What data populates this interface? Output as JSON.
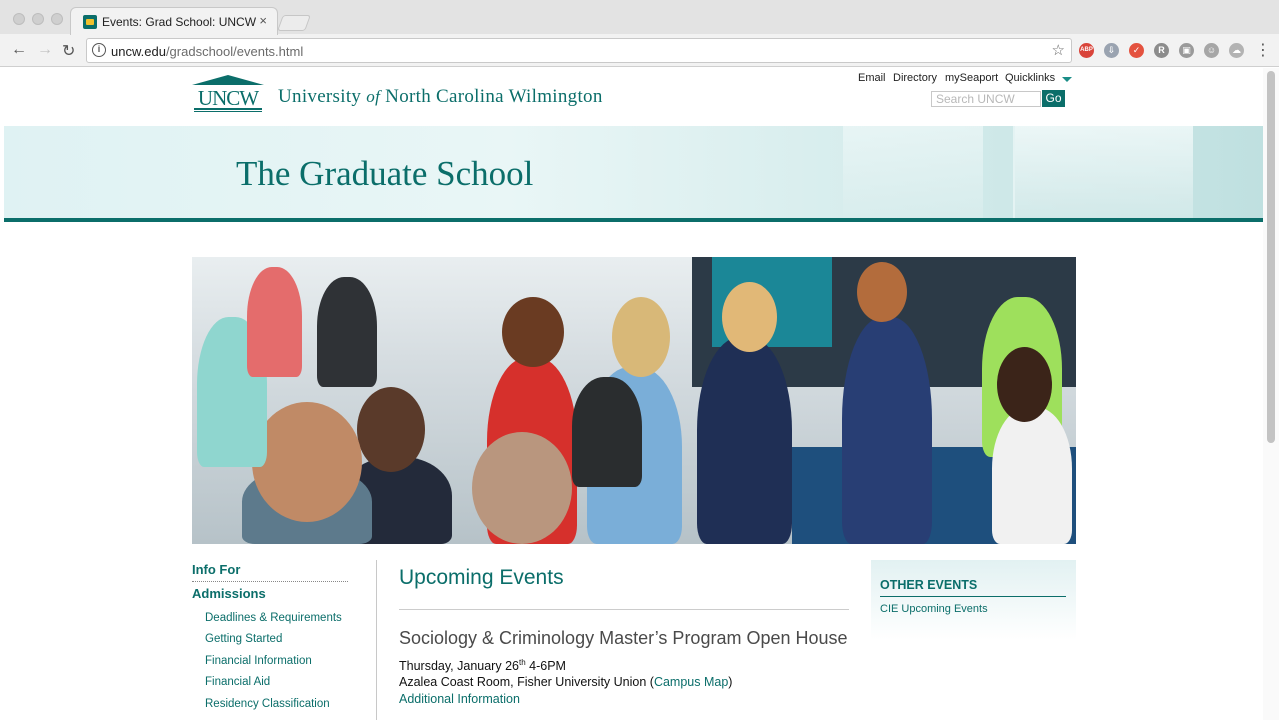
{
  "browser": {
    "tab_title": "Events: Grad School: UNCW",
    "tab_close": "×",
    "url_host": "uncw.edu",
    "url_path": "/gradschool/events.html",
    "info_glyph": "i",
    "star_glyph": "☆",
    "back_glyph": "←",
    "forward_glyph": "→",
    "reload_glyph": "↻",
    "menu_glyph": "⋮",
    "extensions": [
      {
        "name": "adblock-plus-icon",
        "label": "ABP",
        "color": "#d9443a"
      },
      {
        "name": "download-icon",
        "label": "⇩",
        "color": "#9aa3b0"
      },
      {
        "name": "pocket-icon",
        "label": "✓",
        "color": "#e4523f"
      },
      {
        "name": "readability-icon",
        "label": "R",
        "color": "#8c8c8c"
      },
      {
        "name": "screenshot-icon",
        "label": "▣",
        "color": "#9a9a9a"
      },
      {
        "name": "robot-icon",
        "label": "☺",
        "color": "#a6a6a6"
      },
      {
        "name": "cloud-icon",
        "label": "☁",
        "color": "#b3b3b3"
      }
    ]
  },
  "header": {
    "logo_text": "UNCW",
    "university_name_part1": "University",
    "university_name_of": "of",
    "university_name_part2": "North Carolina Wilmington",
    "links": [
      "Email",
      "Directory",
      "mySeaport",
      "Quicklinks"
    ],
    "search_placeholder": "Search UNCW",
    "search_button": "Go"
  },
  "banner": {
    "title": "The Graduate School"
  },
  "colors": {
    "brand_teal": "#0b6e6a"
  },
  "left_nav": {
    "info_for": "Info For",
    "admissions": "Admissions",
    "items": [
      "Deadlines & Requirements",
      "Getting Started",
      "Financial Information",
      "Financial Aid",
      "Residency Classification"
    ]
  },
  "main": {
    "title": "Upcoming Events",
    "event": {
      "title": "Sociology & Criminology Master’s Program Open House",
      "date_prefix": "Thursday, January 26",
      "date_sup": "th",
      "date_suffix": " 4-6PM",
      "location_prefix": "Azalea Coast Room, Fisher University Union (",
      "campus_map": "Campus Map",
      "location_suffix": ")",
      "additional_info": "Additional Information"
    }
  },
  "sidebar": {
    "title": "OTHER EVENTS",
    "link": "CIE Upcoming Events"
  }
}
